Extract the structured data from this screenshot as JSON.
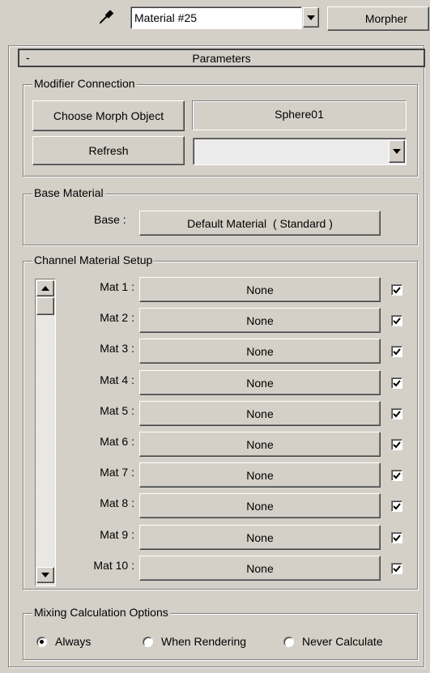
{
  "topbar": {
    "material_name": "Material #25",
    "morpher_label": "Morpher"
  },
  "rollout": {
    "collapse_symbol": "-",
    "title": "Parameters"
  },
  "modifier_connection": {
    "title": "Modifier Connection",
    "choose_label": "Choose Morph Object",
    "object_name": "Sphere01",
    "refresh_label": "Refresh",
    "dropdown_value": ""
  },
  "base_material": {
    "title": "Base Material",
    "base_label": "Base :",
    "base_value": "Default Material  ( Standard )"
  },
  "channel_setup": {
    "title": "Channel Material Setup",
    "rows": [
      {
        "label": "Mat 1 :",
        "value": "None",
        "checked": true
      },
      {
        "label": "Mat 2 :",
        "value": "None",
        "checked": true
      },
      {
        "label": "Mat 3 :",
        "value": "None",
        "checked": true
      },
      {
        "label": "Mat 4 :",
        "value": "None",
        "checked": true
      },
      {
        "label": "Mat 5 :",
        "value": "None",
        "checked": true
      },
      {
        "label": "Mat 6 :",
        "value": "None",
        "checked": true
      },
      {
        "label": "Mat 7 :",
        "value": "None",
        "checked": true
      },
      {
        "label": "Mat 8 :",
        "value": "None",
        "checked": true
      },
      {
        "label": "Mat 9 :",
        "value": "None",
        "checked": true
      },
      {
        "label": "Mat 10 :",
        "value": "None",
        "checked": true
      }
    ]
  },
  "mixing": {
    "title": "Mixing Calculation Options",
    "options": [
      {
        "label": "Always",
        "selected": true
      },
      {
        "label": "When Rendering",
        "selected": false
      },
      {
        "label": "Never Calculate",
        "selected": false
      }
    ]
  }
}
